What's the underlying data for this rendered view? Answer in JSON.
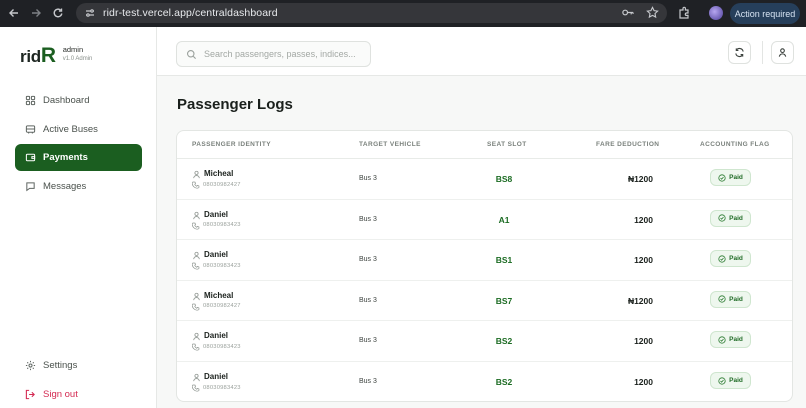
{
  "browser": {
    "url": "ridr-test.vercel.app/centraldashboard",
    "action_label": "Action required"
  },
  "brand": {
    "logo_prefix": "rid",
    "logo_suffix": "R",
    "user": "admin",
    "version": "v1.0 Admin"
  },
  "sidebar": {
    "items": [
      {
        "label": "Dashboard",
        "icon": "grid-icon",
        "active": false
      },
      {
        "label": "Active Buses",
        "icon": "bus-icon",
        "active": false
      },
      {
        "label": "Payments",
        "icon": "wallet-icon",
        "active": true
      },
      {
        "label": "Messages",
        "icon": "message-icon",
        "active": false
      }
    ],
    "settings_label": "Settings",
    "signout_label": "Sign out"
  },
  "topbar": {
    "search_placeholder": "Search passengers, passes, indices..."
  },
  "page": {
    "title": "Passenger Logs"
  },
  "table": {
    "headers": [
      "PASSENGER IDENTITY",
      "TARGET VEHICLE",
      "SEAT SLOT",
      "FARE DEDUCTION",
      "ACCOUNTING FLAG"
    ],
    "rows": [
      {
        "name": "Micheal",
        "phone": "08030982427",
        "vehicle": "Bus 3",
        "seat": "BS8",
        "fare": "₦1200",
        "flag": "Paid"
      },
      {
        "name": "Daniel",
        "phone": "08030983423",
        "vehicle": "Bus 3",
        "seat": "A1",
        "fare": "1200",
        "flag": "Paid"
      },
      {
        "name": "Daniel",
        "phone": "08030983423",
        "vehicle": "Bus 3",
        "seat": "BS1",
        "fare": "1200",
        "flag": "Paid"
      },
      {
        "name": "Micheal",
        "phone": "08030982427",
        "vehicle": "Bus 3",
        "seat": "BS7",
        "fare": "₦1200",
        "flag": "Paid"
      },
      {
        "name": "Daniel",
        "phone": "08030983423",
        "vehicle": "Bus 3",
        "seat": "BS2",
        "fare": "1200",
        "flag": "Paid"
      },
      {
        "name": "Daniel",
        "phone": "08030983423",
        "vehicle": "Bus 3",
        "seat": "BS2",
        "fare": "1200",
        "flag": "Paid"
      }
    ]
  },
  "colors": {
    "accent": "#1b5e20",
    "signout": "#d42a52",
    "paid_bg": "#eef7ee"
  }
}
